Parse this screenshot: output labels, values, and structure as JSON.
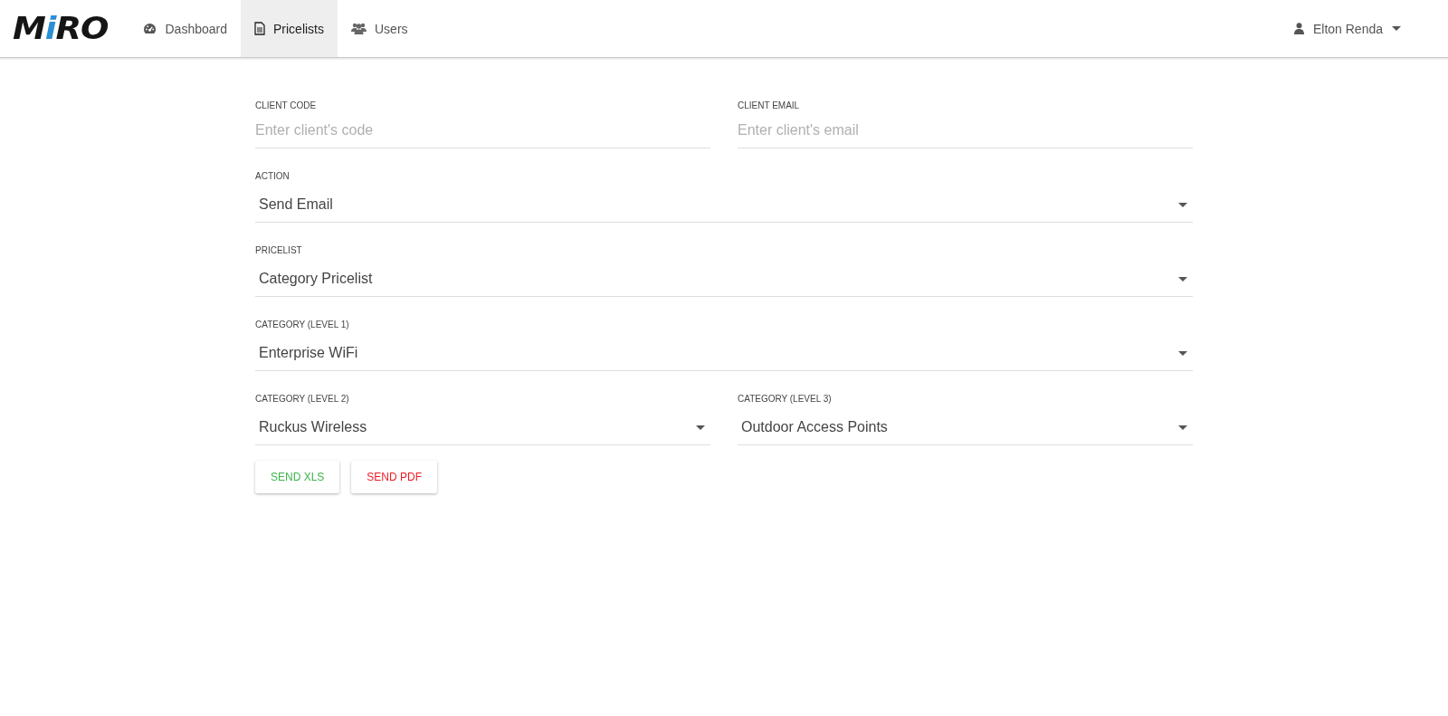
{
  "logo": "MiRO",
  "nav": [
    {
      "label": "Dashboard",
      "selected": false
    },
    {
      "label": "Pricelists",
      "selected": true
    },
    {
      "label": "Users",
      "selected": false
    }
  ],
  "user": {
    "name": "Elton Renda"
  },
  "form": {
    "rows": [
      [
        {
          "label": "CLIENT CODE",
          "kind": "text",
          "placeholder": "Enter client's code"
        },
        {
          "label": "CLIENT EMAIL",
          "kind": "text",
          "placeholder": "Enter client's email"
        }
      ],
      [
        {
          "label": "ACTION",
          "kind": "select",
          "value": "Send Email"
        }
      ],
      [
        {
          "label": "PRICELIST",
          "kind": "select",
          "value": "Category Pricelist"
        }
      ],
      [
        {
          "label": "CATEGORY (LEVEL 1)",
          "kind": "select",
          "value": "Enterprise WiFi"
        }
      ],
      [
        {
          "label": "CATEGORY (LEVEL 2)",
          "kind": "select",
          "value": "Ruckus Wireless"
        },
        {
          "label": "CATEGORY (LEVEL 3)",
          "kind": "select",
          "value": "Outdoor Access Points"
        }
      ]
    ],
    "buttons": [
      {
        "label": "SEND XLS",
        "color": "#3cb54a"
      },
      {
        "label": "SEND PDF",
        "color": "#ee1c24"
      }
    ]
  }
}
